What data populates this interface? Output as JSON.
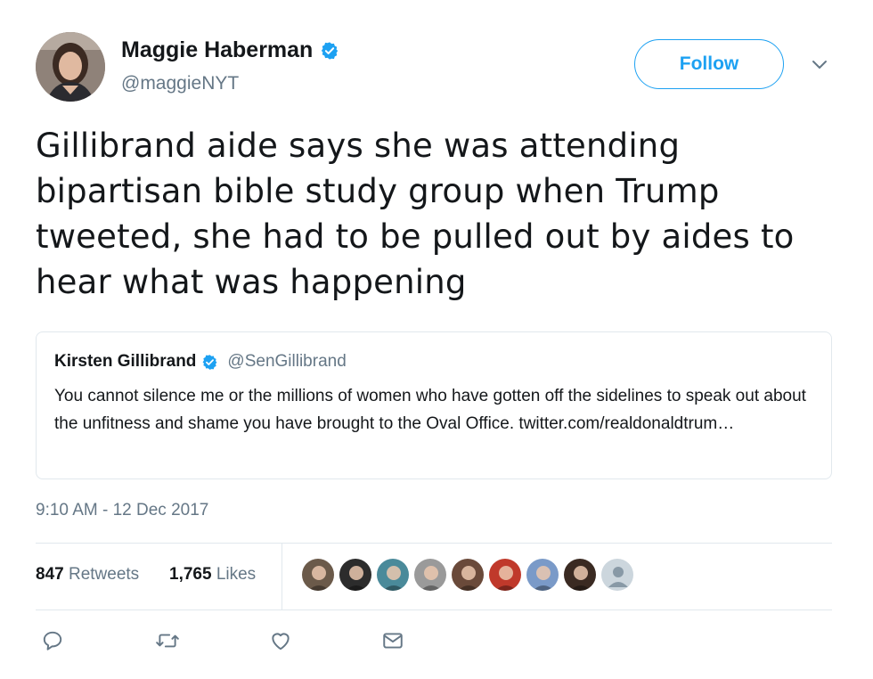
{
  "author": {
    "display_name": "Maggie Haberman",
    "handle": "@maggieNYT",
    "verified": true,
    "avatar_icon": "avatar-photo"
  },
  "follow_button": {
    "label": "Follow"
  },
  "menu_caret_icon": "chevron-down-icon",
  "tweet": {
    "text": "Gillibrand aide says she was attending bipartisan bible study group when Trump tweeted, she had to be pulled out by aides to hear what was happening"
  },
  "quoted_tweet": {
    "display_name": "Kirsten Gillibrand",
    "handle": "@SenGillibrand",
    "verified": true,
    "text": "You cannot silence me or the millions of women who have gotten off the sidelines to speak out about the unfitness and shame you have brought to the Oval Office. twitter.com/realdonaldtrum…"
  },
  "timestamp": "9:10 AM - 12 Dec 2017",
  "stats": {
    "retweets_count": "847",
    "retweets_label": "Retweets",
    "likes_count": "1,765",
    "likes_label": "Likes"
  },
  "likers": [
    {
      "icon": "liker-avatar-1",
      "color": "#6b5a4a"
    },
    {
      "icon": "liker-avatar-2",
      "color": "#2c2c2c"
    },
    {
      "icon": "liker-avatar-3",
      "color": "#4a8a9a"
    },
    {
      "icon": "liker-avatar-4",
      "color": "#9a9a9a"
    },
    {
      "icon": "liker-avatar-5",
      "color": "#6a4a3a"
    },
    {
      "icon": "liker-avatar-6",
      "color": "#c0392b"
    },
    {
      "icon": "liker-avatar-7",
      "color": "#7a9ac8"
    },
    {
      "icon": "liker-avatar-8",
      "color": "#3a2a22"
    },
    {
      "icon": "liker-avatar-9",
      "color": "#ccd6dd"
    }
  ],
  "actions": [
    {
      "icon": "reply-icon"
    },
    {
      "icon": "retweet-icon"
    },
    {
      "icon": "like-icon"
    },
    {
      "icon": "direct-message-icon"
    }
  ],
  "colors": {
    "accent": "#1da1f2",
    "secondary_text": "#657786",
    "border": "#e1e8ed"
  }
}
